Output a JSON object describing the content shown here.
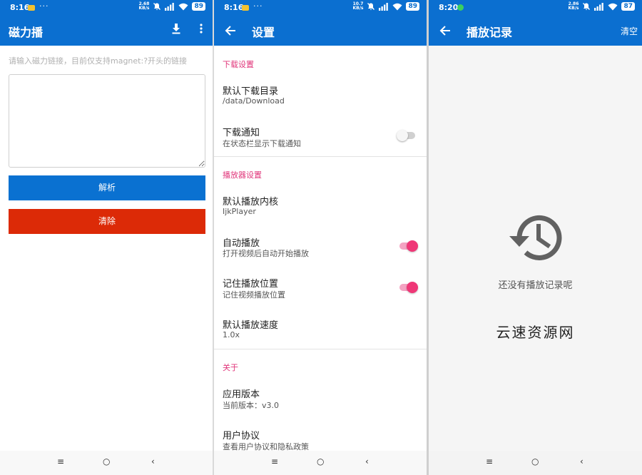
{
  "colors": {
    "primary": "#0b6fd0",
    "parse_button": "#0a71d1",
    "clear_button": "#dc2a07",
    "accent": "#e0357a",
    "switch_on": "#ef3777"
  },
  "screen1": {
    "status": {
      "time": "8:16",
      "dots": "···",
      "netspeed_value": "2.68",
      "netspeed_unit": "KB/s",
      "battery": "89"
    },
    "appbar": {
      "title": "磁力播",
      "download_icon": "download-icon",
      "more_icon": "more-vert-icon"
    },
    "hint": "请输入磁力链接，目前仅支持magnet:?开头的链接",
    "input_value": "",
    "parse_label": "解析",
    "clear_label": "清除"
  },
  "screen2": {
    "status": {
      "time": "8:16",
      "dots": "···",
      "netspeed_value": "10.7",
      "netspeed_unit": "KB/s",
      "battery": "89"
    },
    "appbar": {
      "title": "设置"
    },
    "sections": {
      "download": {
        "title": "下载设置",
        "dir_title": "默认下载目录",
        "dir_value": "/data/Download",
        "notify_title": "下载通知",
        "notify_sub": "在状态栏显示下载通知",
        "notify_on": false
      },
      "player": {
        "title": "播放器设置",
        "core_title": "默认播放内核",
        "core_value": "IjkPlayer",
        "autoplay_title": "自动播放",
        "autoplay_sub": "打开视频后自动开始播放",
        "autoplay_on": true,
        "remember_title": "记住播放位置",
        "remember_sub": "记住视频播放位置",
        "remember_on": true,
        "speed_title": "默认播放速度",
        "speed_value": "1.0x"
      },
      "about": {
        "title": "关于",
        "version_title": "应用版本",
        "version_value": "当前版本：v3.0",
        "agreement_title": "用户协议",
        "agreement_sub": "查看用户协议和隐私政策"
      }
    }
  },
  "screen3": {
    "status": {
      "time": "8:20",
      "netspeed_value": "2.86",
      "netspeed_unit": "KB/s",
      "battery": "87"
    },
    "appbar": {
      "title": "播放记录",
      "clear_label": "清空"
    },
    "empty_icon": "history-icon",
    "empty_text": "还没有播放记录呢",
    "watermark": "云速资源网"
  },
  "navbar": {
    "menu": "≡",
    "home": "○",
    "back": "‹"
  }
}
